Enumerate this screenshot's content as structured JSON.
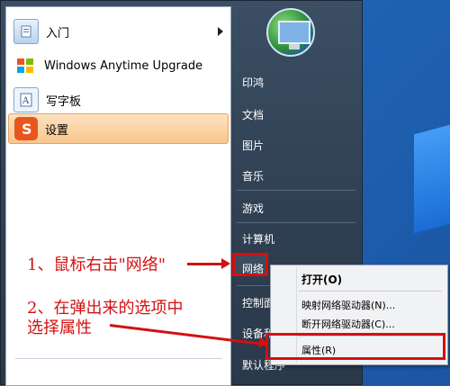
{
  "left_menu": {
    "items": [
      {
        "label": "入门",
        "icon": "getting-started-icon"
      },
      {
        "label": "Windows Anytime Upgrade",
        "icon": "windows-flag-icon"
      },
      {
        "label": "写字板",
        "icon": "wordpad-icon"
      },
      {
        "label": "设置",
        "icon": "sogou-s-icon"
      }
    ]
  },
  "right_menu": {
    "items": [
      "印鸿",
      "文档",
      "图片",
      "音乐",
      "游戏",
      "计算机",
      "网络",
      "控制面",
      "设备和",
      "默认程序"
    ]
  },
  "context_menu": {
    "items": [
      "打开(O)",
      "映射网络驱动器(N)...",
      "断开网络驱动器(C)...",
      "属性(R)"
    ]
  },
  "annotations": {
    "step1": "1、鼠标右击\"网络\"",
    "step2_line1": "2、在弹出来的选项中",
    "step2_line2": "选择属性"
  },
  "colors": {
    "highlight_red": "#d41010",
    "menu_dark": "#2f3f52",
    "selected_orange": "#f9c68d"
  }
}
